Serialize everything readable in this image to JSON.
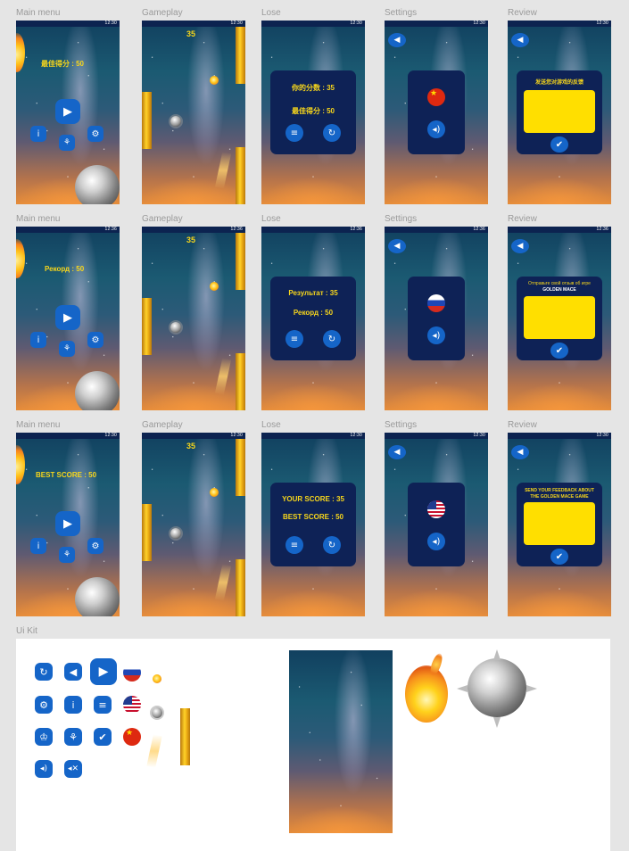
{
  "frames": {
    "main_menu": "Main menu",
    "gameplay": "Gameplay",
    "lose": "Lose",
    "settings": "Settings",
    "review": "Review",
    "ui_kit": "Ui Kit"
  },
  "status_times": {
    "row1": "12:30",
    "row2": "12:36",
    "row3": "12:30"
  },
  "chinese": {
    "best_score": "最佳得分 : 50",
    "your_score": "你的分数 : 35",
    "lose_best": "最佳得分 : 50",
    "review_title": "发送您对游戏的反馈",
    "score": "35"
  },
  "russian": {
    "best_score": "Рекорд : 50",
    "your_score": "Результат : 35",
    "lose_best": "Рекорд : 50",
    "review_title": "Отправьте свой отзыв об игре",
    "review_subtitle": "GOLDEN MACE",
    "score": "35"
  },
  "english": {
    "best_score": "BEST SCORE : 50",
    "your_score": "YOUR SCORE : 35",
    "lose_best": "BEST SCORE : 50",
    "review_title": "SEND YOUR FEEDBACK ABOUT",
    "review_subtitle": "THE GOLDEN MACE GAME",
    "score": "35"
  },
  "icons": {
    "play": "play-icon",
    "info": "info-icon",
    "achievements": "achievements-icon",
    "settings": "gear-icon",
    "back": "back-arrow-icon",
    "menu": "menu-icon",
    "restart": "restart-icon",
    "sound_on": "sound-on-icon",
    "sound_off": "sound-off-icon",
    "check": "check-icon",
    "trophy": "trophy-icon"
  },
  "colors": {
    "button_blue": "#1565c8",
    "panel_navy": "#0e2256",
    "score_yellow": "#f7d61b",
    "feedback_yellow": "#ffdf00",
    "status_bar": "#0c2350"
  }
}
